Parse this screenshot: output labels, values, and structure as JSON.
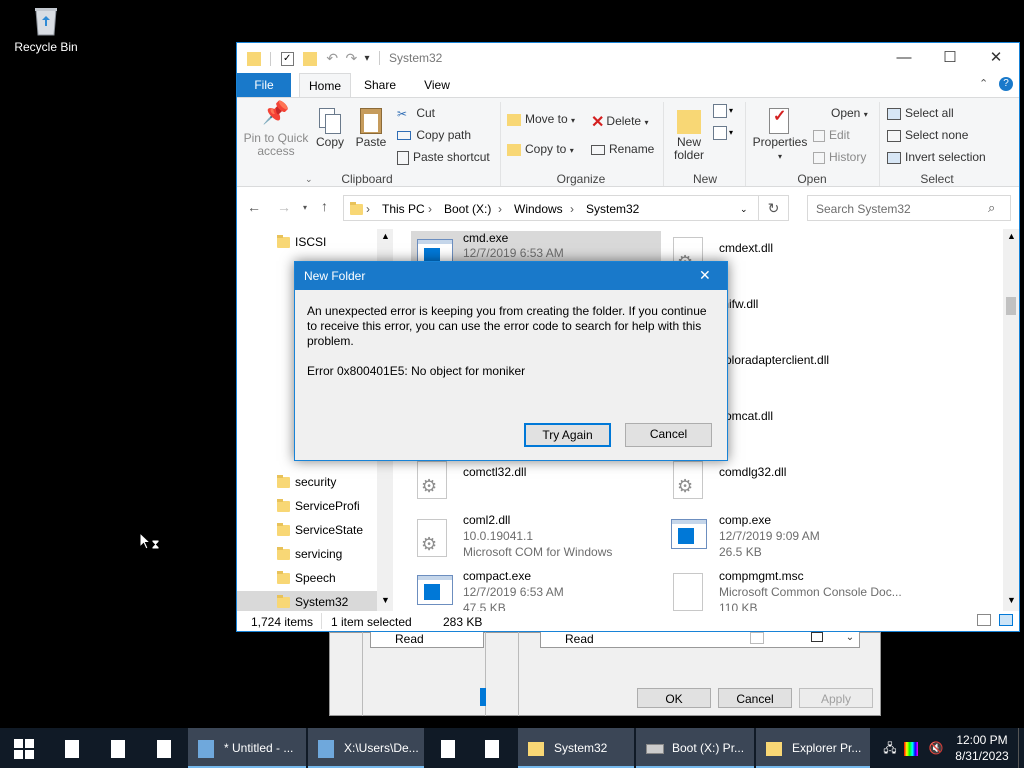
{
  "desktop": {
    "recycle_bin_label": "Recycle Bin"
  },
  "background_dialogs": {
    "field_value_1": "Read",
    "field_value_2": "Read",
    "ok_label": "OK",
    "cancel_label": "Cancel",
    "apply_label": "Apply"
  },
  "explorer": {
    "title": "System32",
    "tabs": {
      "file": "File",
      "home": "Home",
      "share": "Share",
      "view": "View"
    },
    "ribbon": {
      "clipboard": {
        "label": "Clipboard",
        "pin": "Pin to Quick access",
        "copy": "Copy",
        "paste": "Paste",
        "cut": "Cut",
        "copy_path": "Copy path",
        "paste_shortcut": "Paste shortcut"
      },
      "organize": {
        "label": "Organize",
        "move_to": "Move to",
        "copy_to": "Copy to",
        "delete": "Delete",
        "rename": "Rename"
      },
      "new": {
        "label": "New",
        "new_folder": "New folder"
      },
      "open": {
        "label": "Open",
        "properties": "Properties",
        "open": "Open",
        "edit": "Edit",
        "history": "History"
      },
      "select": {
        "label": "Select",
        "select_all": "Select all",
        "select_none": "Select none",
        "invert_selection": "Invert selection"
      }
    },
    "address": {
      "crumbs": [
        "This PC",
        "Boot (X:)",
        "Windows",
        "System32"
      ],
      "search_placeholder": "Search System32"
    },
    "nav_items": [
      "ISCSI",
      "security",
      "ServiceProfi",
      "ServiceState",
      "servicing",
      "Speech",
      "System32"
    ],
    "nav_partial": "...",
    "files": [
      {
        "name": "cmd.exe",
        "line2": "12/7/2019 6:53 AM",
        "line3": "",
        "icon": "exe"
      },
      {
        "name": "cmdext.dll",
        "line2": "",
        "line3": "",
        "icon": "dll"
      },
      {
        "name": "mifw.dll",
        "line2": "",
        "line3": "",
        "icon": "dll"
      },
      {
        "name": "coloradapterclient.dll",
        "line2": "",
        "line3": "",
        "icon": "dll"
      },
      {
        "name": "comcat.dll",
        "line2": "",
        "line3": "",
        "icon": "dll"
      },
      {
        "name": "comctl32.dll",
        "line2": "",
        "line3": "",
        "icon": "dll"
      },
      {
        "name": "comdlg32.dll",
        "line2": "",
        "line3": "",
        "icon": "dll"
      },
      {
        "name": "coml2.dll",
        "line2": "10.0.19041.1",
        "line3": "Microsoft COM for Windows",
        "icon": "dll"
      },
      {
        "name": "comp.exe",
        "line2": "12/7/2019 9:09 AM",
        "line3": "26.5 KB",
        "icon": "exe"
      },
      {
        "name": "compact.exe",
        "line2": "12/7/2019 6:53 AM",
        "line3": "47.5 KB",
        "icon": "exe"
      },
      {
        "name": "compmgmt.msc",
        "line2": "Microsoft Common Console Doc...",
        "line3": "110 KB",
        "icon": "msc"
      }
    ],
    "status": {
      "item_count": "1,724 items",
      "selected": "1 item selected",
      "size": "283 KB"
    }
  },
  "dialog": {
    "title": "New Folder",
    "message": "An unexpected error is keeping you from creating the folder. If you continue to receive this error, you can use the error code to search for help with this problem.",
    "error": "Error 0x800401E5: No object for moniker",
    "try_again": "Try Again",
    "cancel": "Cancel"
  },
  "taskbar": {
    "items": [
      {
        "label": "* Untitled - ...",
        "active": true
      },
      {
        "label": "X:\\Users\\De...",
        "active": true
      },
      {
        "label": "System32",
        "active": true
      },
      {
        "label": "Boot (X:) Pr...",
        "active": true
      },
      {
        "label": "Explorer Pr...",
        "active": true
      }
    ],
    "clock_time": "12:00 PM",
    "clock_date": "8/31/2023"
  }
}
